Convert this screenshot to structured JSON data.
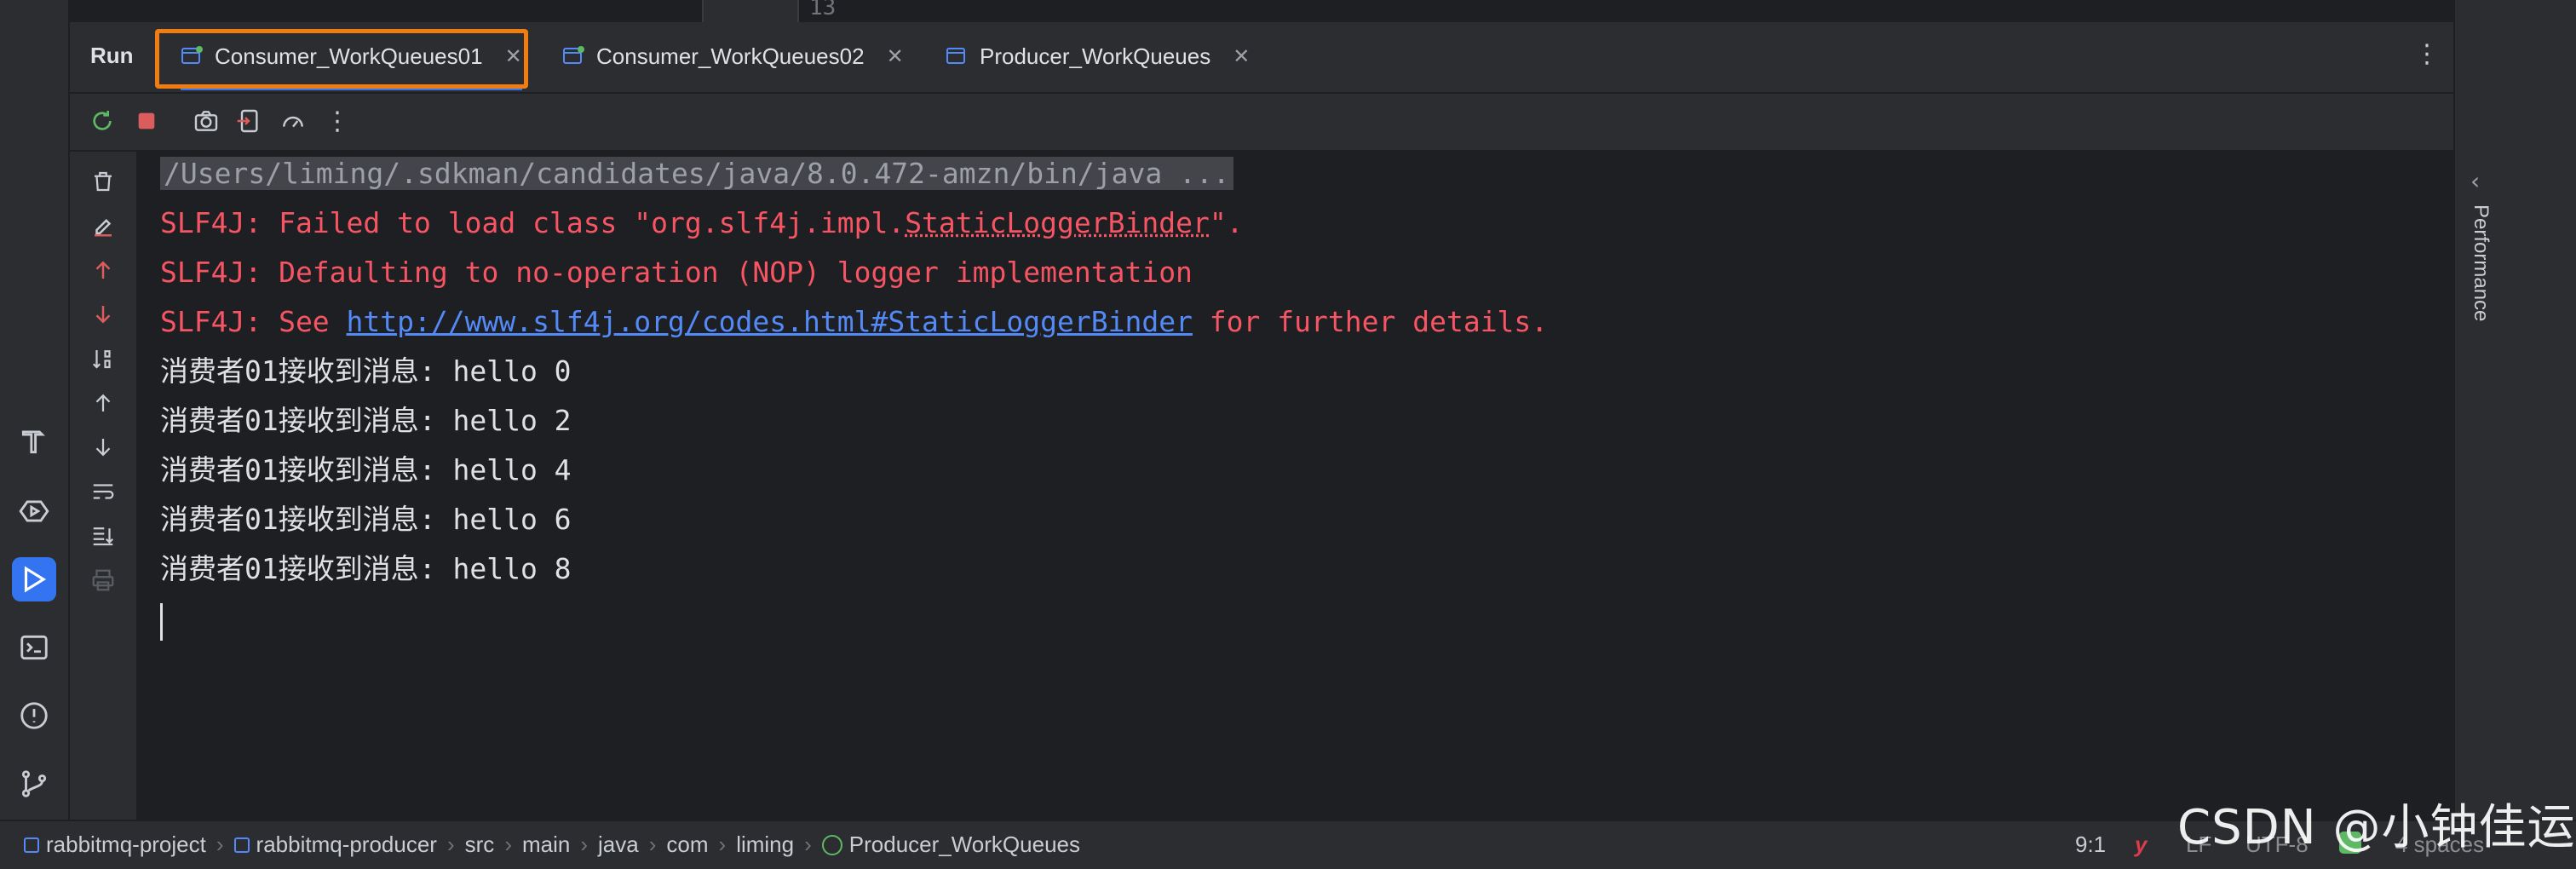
{
  "editor": {
    "line_number": "13"
  },
  "run_panel": {
    "title": "Run",
    "tabs": [
      {
        "label": "Consumer_WorkQueues01",
        "selected": true
      },
      {
        "label": "Consumer_WorkQueues02",
        "selected": false
      },
      {
        "label": "Producer_WorkQueues",
        "selected": false
      }
    ],
    "more_icon": "more-vertical-icon",
    "minimize_icon": "minimize-icon"
  },
  "toolbar": {
    "icons": [
      "rerun-icon",
      "stop-icon",
      "camera-icon",
      "exit-icon",
      "profiler-icon",
      "more-icon"
    ]
  },
  "console": {
    "command_line": "/Users/liming/.sdkman/candidates/java/8.0.472-amzn/bin/java ...",
    "slf4j_line1_prefix": "SLF4J: Failed to load class \"org.slf4j.impl.",
    "slf4j_line1_class": "StaticLoggerBinder",
    "slf4j_line1_suffix": "\".",
    "slf4j_line2": "SLF4J: Defaulting to no-operation (NOP) logger implementation",
    "slf4j_line3_prefix": "SLF4J: See ",
    "slf4j_line3_link": "http://www.slf4j.org/codes.html#StaticLoggerBinder",
    "slf4j_line3_suffix": " for further details.",
    "messages": [
      "消费者01接收到消息: hello 0",
      "消费者01接收到消息: hello 2",
      "消费者01接收到消息: hello 4",
      "消费者01接收到消息: hello 6",
      "消费者01接收到消息: hello 8"
    ]
  },
  "right_panel": {
    "label": "Performance"
  },
  "status_bar": {
    "breadcrumbs": [
      "rabbitmq-project",
      "rabbitmq-producer",
      "src",
      "main",
      "java",
      "com",
      "liming",
      "Producer_WorkQueues"
    ],
    "position": "9:1",
    "line_separator": "LF",
    "encoding": "UTF-8",
    "indent": "4 spaces"
  },
  "watermark": "CSDN @小钟佳运",
  "colors": {
    "accent": "#3574f0",
    "highlight": "#f07d12",
    "error": "#f75464",
    "link": "#548af7"
  }
}
